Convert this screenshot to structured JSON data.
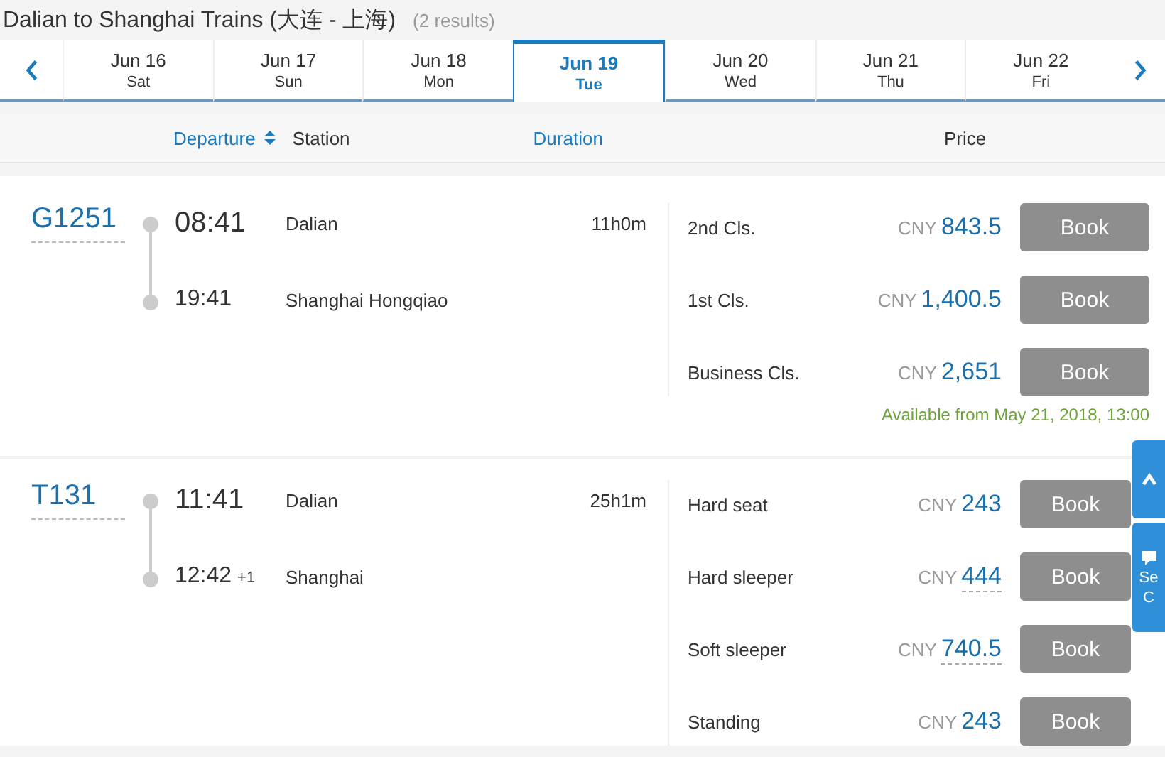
{
  "title": {
    "text": "Dalian to Shanghai Trains (大连 - 上海)",
    "count": "(2 results)"
  },
  "date_tabs": [
    {
      "date": "Jun 16",
      "day": "Sat",
      "selected": false
    },
    {
      "date": "Jun 17",
      "day": "Sun",
      "selected": false
    },
    {
      "date": "Jun 18",
      "day": "Mon",
      "selected": false
    },
    {
      "date": "Jun 19",
      "day": "Tue",
      "selected": true
    },
    {
      "date": "Jun 20",
      "day": "Wed",
      "selected": false
    },
    {
      "date": "Jun 21",
      "day": "Thu",
      "selected": false
    },
    {
      "date": "Jun 22",
      "day": "Fri",
      "selected": false
    }
  ],
  "columns": {
    "departure": "Departure",
    "station": "Station",
    "duration": "Duration",
    "price": "Price"
  },
  "trains": [
    {
      "number": "G1251",
      "depart_time": "08:41",
      "depart_station": "Dalian",
      "arrive_time": "19:41",
      "arrive_station": "Shanghai Hongqiao",
      "duration": "11h0m",
      "fares": [
        {
          "class": "2nd Cls.",
          "currency": "CNY",
          "price": "843.5",
          "underlined": false,
          "button": "Book",
          "disabled": true
        },
        {
          "class": "1st Cls.",
          "currency": "CNY",
          "price": "1,400.5",
          "underlined": false,
          "button": "Book",
          "disabled": true
        },
        {
          "class": "Business Cls.",
          "currency": "CNY",
          "price": "2,651",
          "underlined": false,
          "button": "Book",
          "disabled": true
        }
      ],
      "note": "Available from May 21, 2018, 13:00"
    },
    {
      "number": "T131",
      "depart_time": "11:41",
      "depart_station": "Dalian",
      "arrive_time": "12:42",
      "arrive_day": "+1",
      "arrive_station": "Shanghai",
      "duration": "25h1m",
      "fares": [
        {
          "class": "Hard seat",
          "currency": "CNY",
          "price": "243",
          "underlined": false,
          "button": "Book",
          "disabled": true
        },
        {
          "class": "Hard sleeper",
          "currency": "CNY",
          "price": "444",
          "underlined": true,
          "button": "Book",
          "disabled": true
        },
        {
          "class": "Soft sleeper",
          "currency": "CNY",
          "price": "740.5",
          "underlined": true,
          "button": "Book",
          "disabled": true
        },
        {
          "class": "Standing",
          "currency": "CNY",
          "price": "243",
          "underlined": false,
          "button": "Book",
          "disabled": true
        }
      ]
    }
  ],
  "side_widget": {
    "chat_label": [
      "Se",
      "C"
    ]
  }
}
